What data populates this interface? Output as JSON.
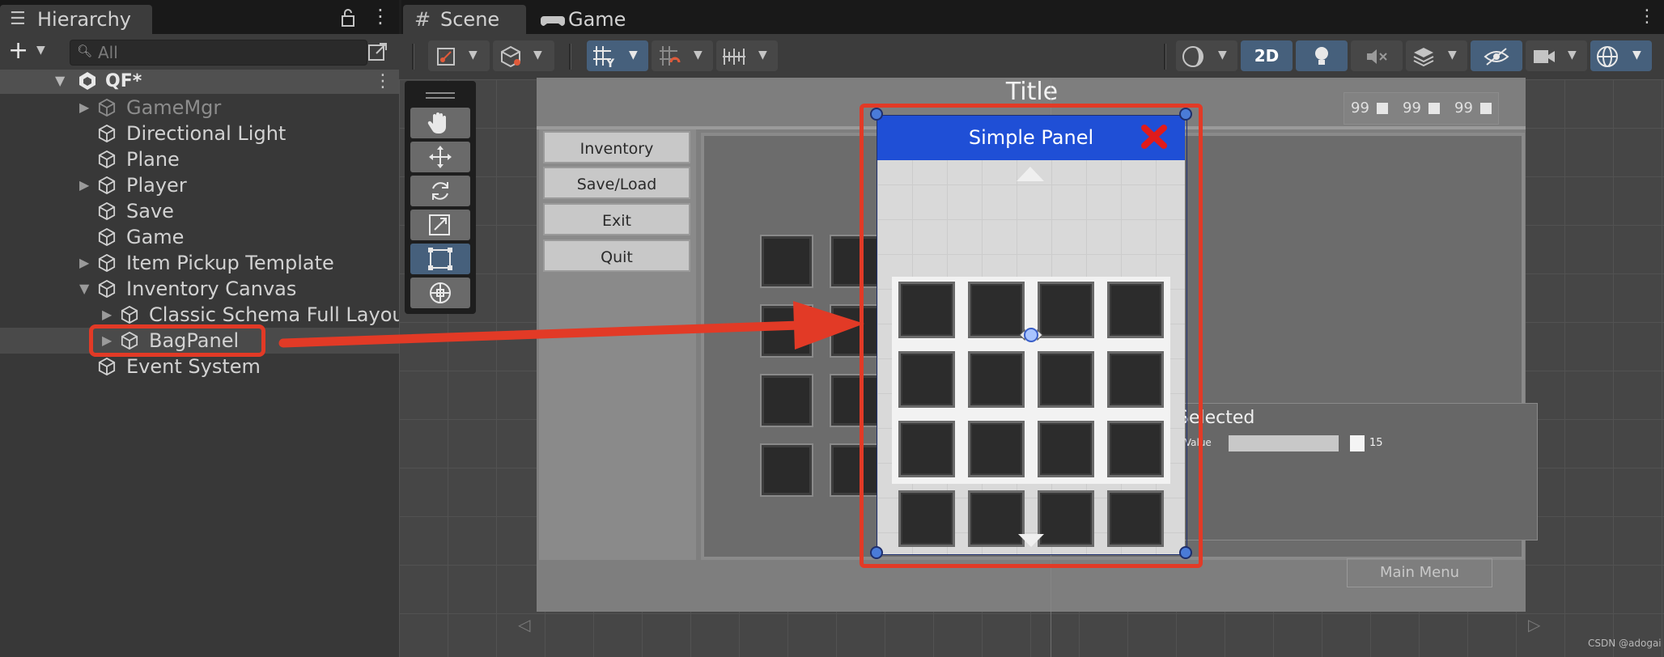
{
  "hierarchy": {
    "tab_label": "Hierarchy",
    "search_placeholder": "All",
    "scene_name": "QF*",
    "items": [
      {
        "label": "GameMgr",
        "expandable": true,
        "dimmed": true,
        "depth": 1
      },
      {
        "label": "Directional Light",
        "expandable": false,
        "depth": 1
      },
      {
        "label": "Plane",
        "expandable": false,
        "depth": 1
      },
      {
        "label": "Player",
        "expandable": true,
        "depth": 1
      },
      {
        "label": "Save",
        "expandable": false,
        "depth": 1
      },
      {
        "label": "Game",
        "expandable": false,
        "depth": 1
      },
      {
        "label": "Item Pickup Template",
        "expandable": true,
        "depth": 1
      },
      {
        "label": "Inventory Canvas",
        "expandable": true,
        "expanded": true,
        "depth": 1
      },
      {
        "label": "Classic Schema Full Layout",
        "expandable": true,
        "depth": 2
      },
      {
        "label": "BagPanel",
        "expandable": true,
        "depth": 2,
        "selected": true
      },
      {
        "label": "Event System",
        "expandable": false,
        "depth": 1
      }
    ]
  },
  "tabs": {
    "scene": "Scene",
    "game": "Game"
  },
  "toolbar": {
    "mode_2d": "2D"
  },
  "scene_ui": {
    "title": "Title",
    "counters": [
      "99",
      "99",
      "99"
    ],
    "menu_buttons": [
      "Inventory",
      "Save/Load",
      "Exit",
      "Quit"
    ],
    "panel_title": "Simple Panel",
    "selected_label": "Selected",
    "value_label": ": Value",
    "value_number": "15",
    "main_menu": "Main Menu"
  },
  "colors": {
    "highlight": "#e23a26",
    "panel_header": "#1f4fd6",
    "close_x": "#e01b1b",
    "selection_handle": "#4a7bd8"
  },
  "watermark": "CSDN @adogai"
}
